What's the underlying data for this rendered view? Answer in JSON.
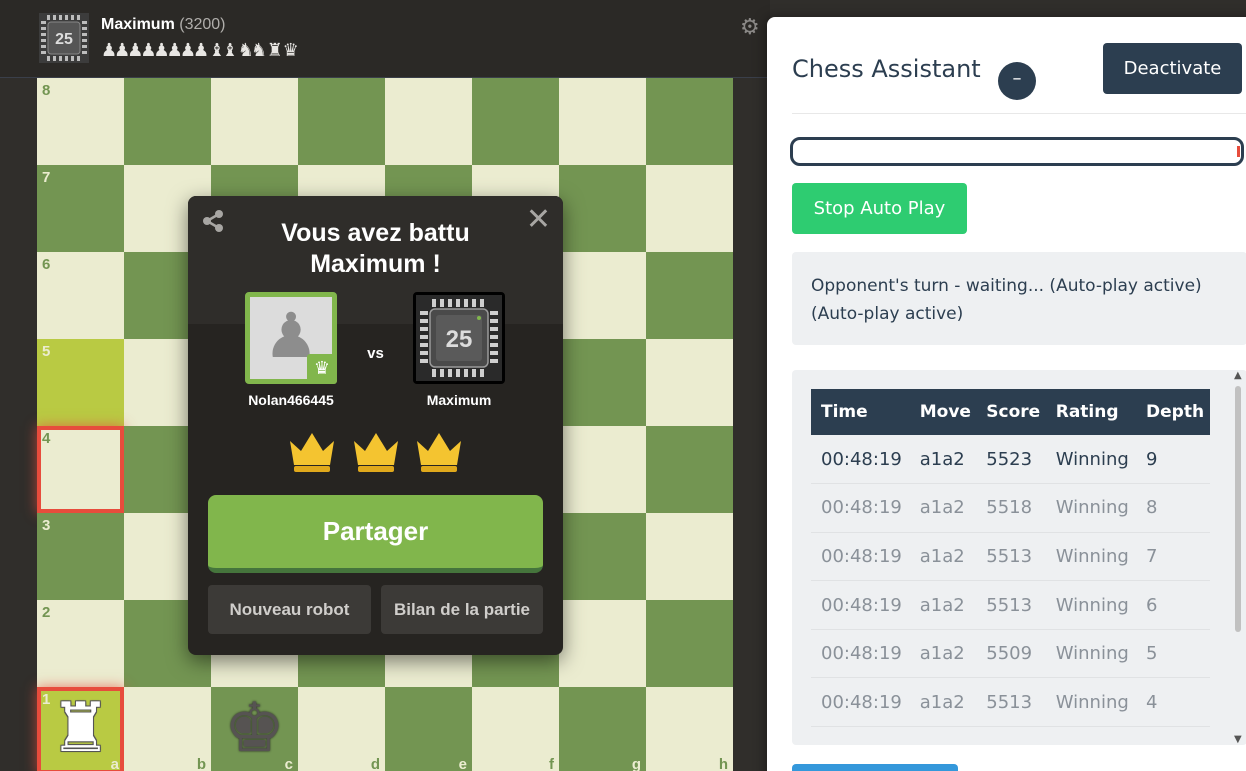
{
  "header": {
    "opponent_name": "Maximum",
    "opponent_rating": "(3200)",
    "bot_level": "25",
    "captured_pieces": "♟♟♟♟♟♟♟♟ ♝♝ ♞♞ ♜ ♛",
    "settings_icon": "gear-icon"
  },
  "board": {
    "ranks": [
      "8",
      "7",
      "6",
      "5",
      "4",
      "3",
      "2",
      "1"
    ],
    "files": [
      "a",
      "b",
      "c",
      "d",
      "e",
      "f",
      "g",
      "h"
    ],
    "pieces": {
      "a1": "♜",
      "c1": "♚"
    },
    "colors": {
      "light": "#ebecd0",
      "dark": "#739552",
      "highlight_light": "#f5f682",
      "highlight_dark": "#b9ca43",
      "last_move_box": "#e74c3c"
    }
  },
  "game_over": {
    "title": "Vous avez battu Maximum !",
    "player_name": "Nolan466445",
    "vs_label": "vs",
    "opponent_name": "Maximum",
    "opponent_level": "25",
    "share_button": "Partager",
    "new_bot_button": "Nouveau robot",
    "review_button": "Bilan de la partie",
    "crowns": 3,
    "icons": {
      "share": "share-icon",
      "close": "close-icon",
      "crown": "crown-icon"
    },
    "accent": "#81b64c"
  },
  "assistant": {
    "title": "Chess Assistant",
    "minimize_label": "–",
    "deactivate_label": "Deactivate",
    "stop_label": "Stop Auto Play",
    "status_text": "Opponent's turn - waiting... (Auto-play active) (Auto-play active)",
    "table": {
      "headers": [
        "Time",
        "Move",
        "Score",
        "Rating",
        "Depth"
      ],
      "rows": [
        [
          "00:48:19",
          "a1a2",
          "5523",
          "Winning",
          "9"
        ],
        [
          "00:48:19",
          "a1a2",
          "5518",
          "Winning",
          "8"
        ],
        [
          "00:48:19",
          "a1a2",
          "5513",
          "Winning",
          "7"
        ],
        [
          "00:48:19",
          "a1a2",
          "5513",
          "Winning",
          "6"
        ],
        [
          "00:48:19",
          "a1a2",
          "5509",
          "Winning",
          "5"
        ],
        [
          "00:48:19",
          "a1a2",
          "5513",
          "Winning",
          "4"
        ]
      ]
    },
    "colors": {
      "primary": "#2c3e50",
      "success": "#2ecc71",
      "blue": "#3498db"
    }
  }
}
